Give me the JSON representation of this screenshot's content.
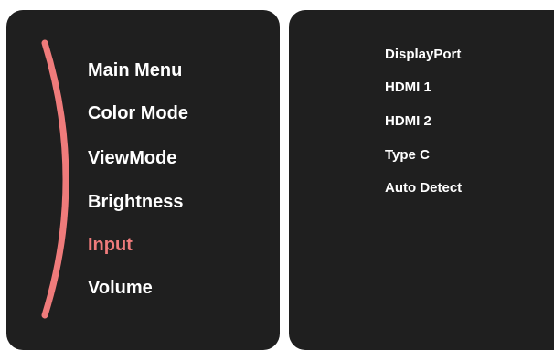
{
  "menu": {
    "items": [
      {
        "label": "Main Menu"
      },
      {
        "label": "Color Mode"
      },
      {
        "label": "ViewMode"
      },
      {
        "label": "Brightness"
      },
      {
        "label": "Input",
        "selected": true
      },
      {
        "label": "Volume"
      }
    ]
  },
  "submenu": {
    "items": [
      {
        "label": "DisplayPort"
      },
      {
        "label": "HDMI 1"
      },
      {
        "label": "HDMI 2"
      },
      {
        "label": "Type C"
      },
      {
        "label": "Auto Detect"
      }
    ]
  },
  "colors": {
    "panel_background": "#1f1f1f",
    "accent": "#ef7b7b",
    "text": "#ffffff"
  },
  "icons": {
    "scroll_indicator": "curved-arc-indicator"
  }
}
